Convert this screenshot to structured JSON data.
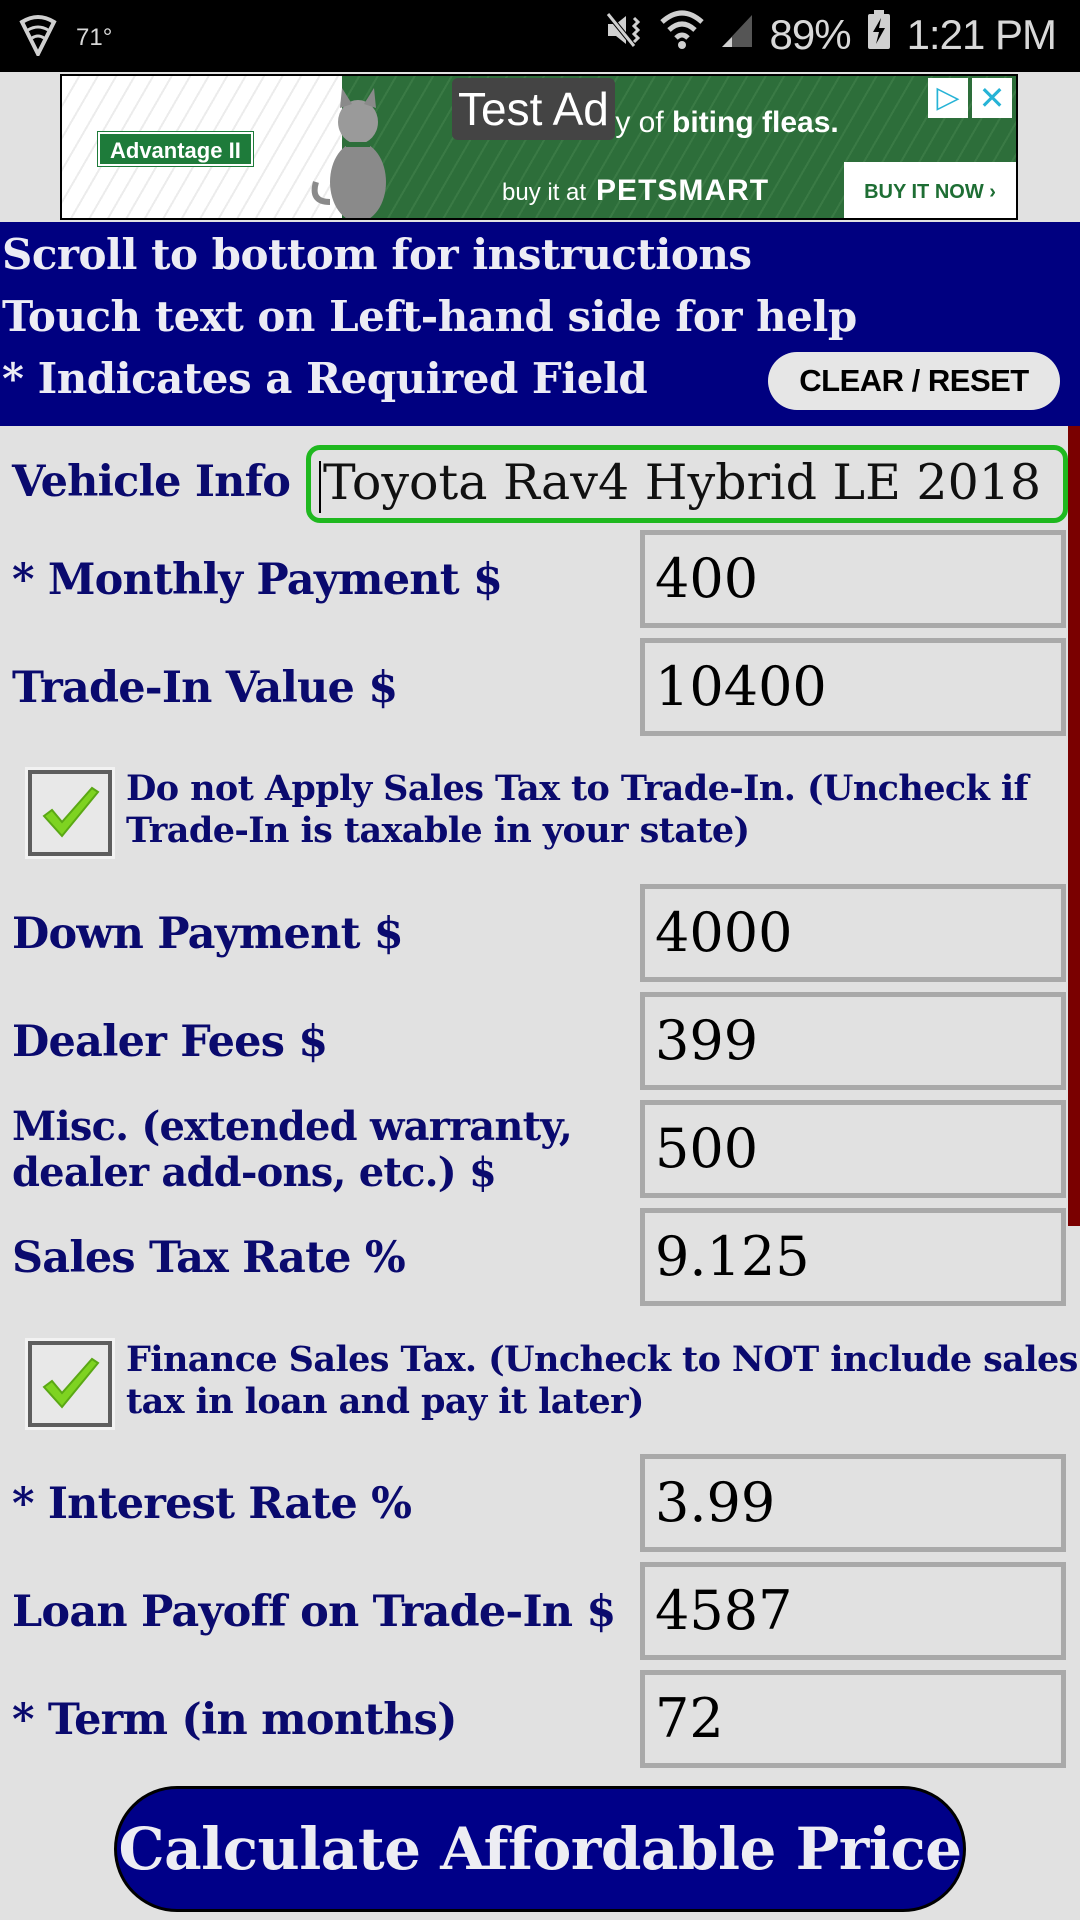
{
  "status_bar": {
    "temperature": "71°",
    "battery_percent": "89%",
    "time": "1:21 PM",
    "icons": [
      "shield-icon",
      "vibrate-mute-icon",
      "wifi-icon",
      "signal-icon",
      "battery-charging-icon"
    ]
  },
  "ad": {
    "label": "Test Ad",
    "brand": "Advantage II",
    "headline_prefix": "misery of",
    "headline_bold": "biting fleas.",
    "buy_text": "buy it at",
    "store": "PETSMART",
    "cta": "BUY IT NOW ›",
    "adchoices_icon": "▷",
    "close_icon": "✕"
  },
  "header": {
    "line1": "Scroll to bottom for instructions",
    "line2": "Touch text on Left-hand side for help",
    "line3": "* Indicates a Required Field",
    "clear_button": "CLEAR / RESET"
  },
  "form": {
    "vehicle_info": {
      "label": "Vehicle Info",
      "value": "Toyota Rav4 Hybrid LE 2018"
    },
    "monthly_payment": {
      "label": "* Monthly Payment $",
      "value": "400"
    },
    "trade_in_value": {
      "label": "Trade-In Value $",
      "value": "10400"
    },
    "no_tax_trade_in": {
      "checked": true,
      "line1": "Do not Apply Sales Tax to Trade-In. (Uncheck if",
      "line2": "Trade-In is taxable in your state)"
    },
    "down_payment": {
      "label": "Down Payment $",
      "value": "4000"
    },
    "dealer_fees": {
      "label": "Dealer Fees $",
      "value": "399"
    },
    "misc": {
      "label_line1": "Misc. (extended warranty,",
      "label_line2": "dealer add-ons, etc.) $",
      "value": "500"
    },
    "sales_tax_rate": {
      "label": "Sales Tax Rate %",
      "value": "9.125"
    },
    "finance_sales_tax": {
      "checked": true,
      "line1": "Finance Sales Tax. (Uncheck to NOT include sales",
      "line2": "tax in loan and pay it later)"
    },
    "interest_rate": {
      "label": "* Interest Rate %",
      "value": "3.99"
    },
    "loan_payoff": {
      "label": "Loan Payoff on Trade-In $",
      "value": "4587"
    },
    "term": {
      "label": "* Term (in months)",
      "value": "72"
    }
  },
  "calculate_button": "Calculate Affordable Price",
  "colors": {
    "header_bg": "#000080",
    "label_text": "#0a0a6e",
    "focus_border": "#1fb81f",
    "scrollbar": "#7a0000",
    "page_bg": "#e1e1e1"
  }
}
